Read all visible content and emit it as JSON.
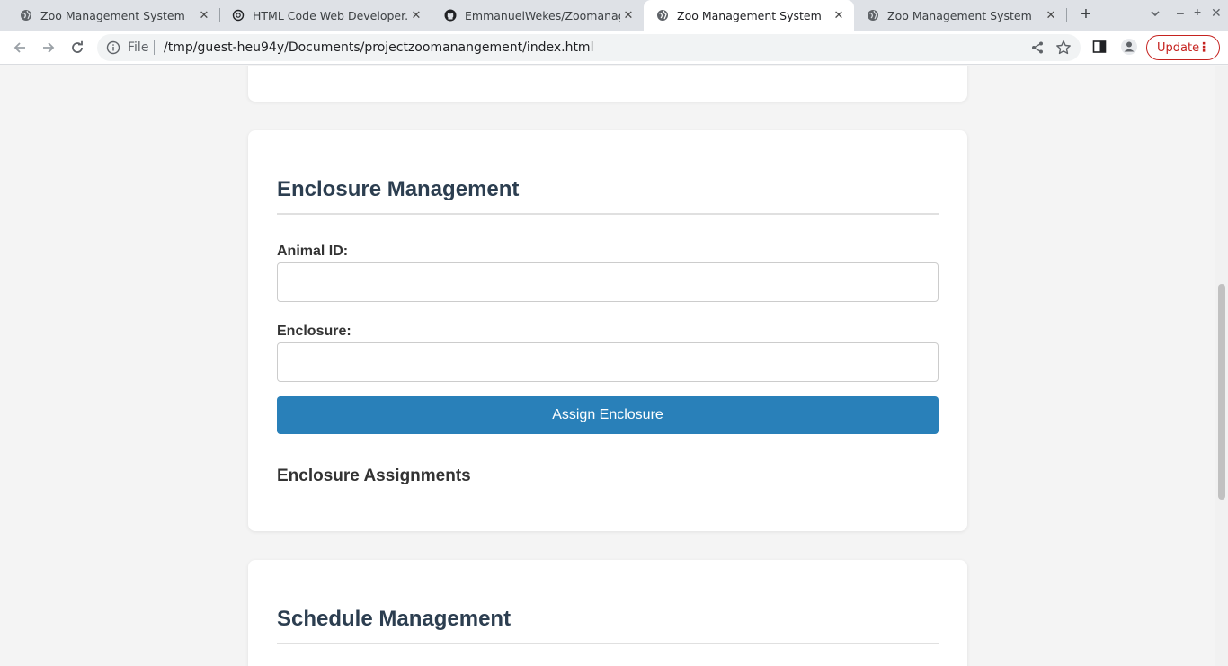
{
  "browser": {
    "tabs": [
      {
        "title": "Zoo Management System",
        "active": false,
        "icon": "globe-icon"
      },
      {
        "title": "HTML Code Web Developer.",
        "active": false,
        "icon": "chatgpt-icon"
      },
      {
        "title": "EmmanuelWekes/Zoomanage",
        "active": false,
        "icon": "github-icon"
      },
      {
        "title": "Zoo Management System",
        "active": true,
        "icon": "globe-icon"
      },
      {
        "title": "Zoo Management System",
        "active": false,
        "icon": "globe-icon"
      }
    ],
    "address": {
      "scheme": "File",
      "url": "/tmp/guest-heu94y/Documents/projectzoomanangement/index.html"
    },
    "update_label": "Update"
  },
  "enclosure": {
    "title": "Enclosure Management",
    "animal_id_label": "Animal ID:",
    "animal_id_value": "",
    "enclosure_label": "Enclosure:",
    "enclosure_value": "",
    "assign_button": "Assign Enclosure",
    "assignments_title": "Enclosure Assignments"
  },
  "schedule": {
    "title": "Schedule Management"
  },
  "colors": {
    "primary": "#2980b9",
    "heading": "#2c3e50",
    "background": "#f4f4f4"
  }
}
